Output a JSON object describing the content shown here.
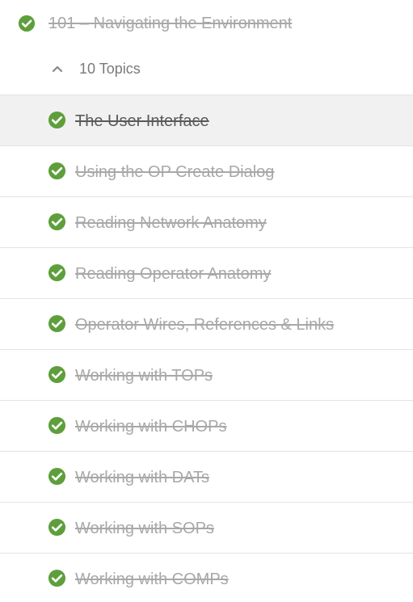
{
  "lesson": {
    "title": "101 – Navigating the Environment",
    "status": "complete"
  },
  "topics_toggle": {
    "label": "10 Topics",
    "expanded": true
  },
  "topics": [
    {
      "label": "The User Interface",
      "status": "complete",
      "active": true
    },
    {
      "label": "Using the OP Create Dialog",
      "status": "complete",
      "active": false
    },
    {
      "label": "Reading Network Anatomy",
      "status": "complete",
      "active": false
    },
    {
      "label": "Reading Operator Anatomy",
      "status": "complete",
      "active": false
    },
    {
      "label": "Operator Wires, References & Links",
      "status": "complete",
      "active": false
    },
    {
      "label": "Working with TOPs",
      "status": "complete",
      "active": false
    },
    {
      "label": "Working with CHOPs",
      "status": "complete",
      "active": false
    },
    {
      "label": "Working with DATs",
      "status": "complete",
      "active": false
    },
    {
      "label": "Working with SOPs",
      "status": "complete",
      "active": false
    },
    {
      "label": "Working with COMPs",
      "status": "complete",
      "active": false
    }
  ],
  "icons": {
    "complete": "check-circle-icon",
    "collapse": "chevron-up-icon"
  },
  "colors": {
    "check_green": "#5e9f3c",
    "active_row_bg": "#f1f1f1",
    "completed_text": "#a8a8a8",
    "active_text": "#5a5a5a"
  }
}
